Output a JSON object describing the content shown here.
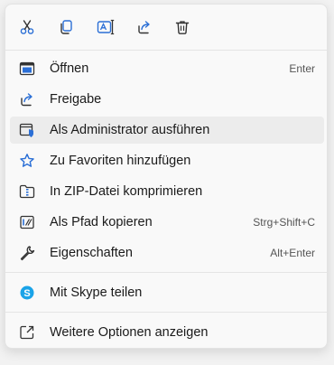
{
  "toolbar": {
    "buttons": [
      {
        "name": "cut-icon"
      },
      {
        "name": "copy-icon"
      },
      {
        "name": "rename-icon"
      },
      {
        "name": "share-icon"
      },
      {
        "name": "delete-icon"
      }
    ]
  },
  "menu": {
    "items": [
      {
        "label": "Öffnen",
        "shortcut": "Enter",
        "icon": "open-window-icon"
      },
      {
        "label": "Freigabe",
        "shortcut": "",
        "icon": "share-icon"
      },
      {
        "label": "Als Administrator ausführen",
        "shortcut": "",
        "icon": "admin-shield-icon"
      },
      {
        "label": "Zu Favoriten hinzufügen",
        "shortcut": "",
        "icon": "star-icon"
      },
      {
        "label": "In ZIP-Datei komprimieren",
        "shortcut": "",
        "icon": "zip-folder-icon"
      },
      {
        "label": "Als Pfad kopieren",
        "shortcut": "Strg+Shift+C",
        "icon": "copy-path-icon"
      },
      {
        "label": "Eigenschaften",
        "shortcut": "Alt+Enter",
        "icon": "wrench-icon"
      },
      {
        "label": "Mit Skype teilen",
        "shortcut": "",
        "icon": "skype-icon"
      },
      {
        "label": "Weitere Optionen anzeigen",
        "shortcut": "",
        "icon": "more-options-icon"
      }
    ]
  },
  "colors": {
    "accent": "#2b6fd6",
    "skype": "#1aa3e8",
    "hover": "#ececec"
  }
}
